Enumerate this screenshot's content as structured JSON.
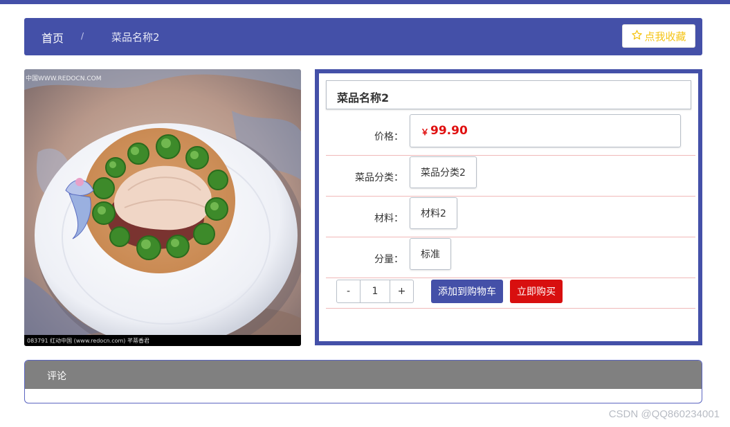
{
  "breadcrumb": {
    "home": "首页",
    "separator": "/",
    "current": "菜品名称2"
  },
  "favorite_button": {
    "label": "点我收藏",
    "icon": "star-outline-icon"
  },
  "dish": {
    "title": "菜品名称2",
    "image_caption": "083791  红动中国 (www.redocn.com)  芊蒂香君",
    "image_watermark": "中国WWW.REDOCN.COM",
    "fields": [
      {
        "label": "价格：",
        "currency": "￥",
        "value": "99.90"
      },
      {
        "label": "菜品分类：",
        "value": "菜品分类2"
      },
      {
        "label": "材料：",
        "value": "材料2"
      },
      {
        "label": "分量：",
        "value": "标准"
      }
    ]
  },
  "quantity": {
    "minus": "-",
    "value": "1",
    "plus": "+"
  },
  "actions": {
    "add_to_cart": "添加到购物车",
    "buy_now": "立即购买"
  },
  "comments": {
    "title": "评论"
  },
  "watermark": "CSDN @QQ860234001",
  "colors": {
    "primary": "#4450a8",
    "price": "#e01010",
    "buy": "#d80f0f",
    "star": "#f5c518"
  }
}
